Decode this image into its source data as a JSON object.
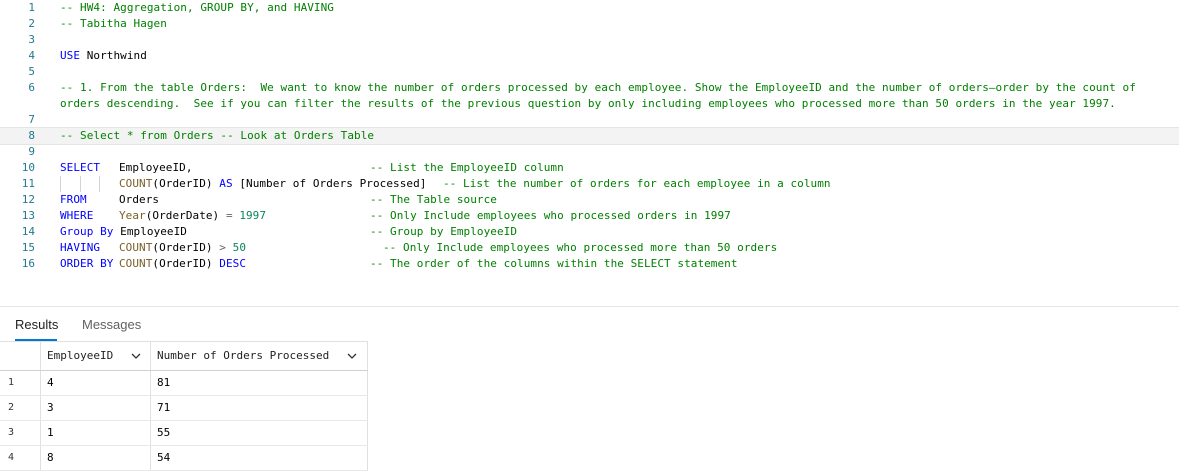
{
  "editor": {
    "line_numbers": [
      "1",
      "2",
      "3",
      "4",
      "5",
      "6",
      "7",
      "8",
      "9",
      "10",
      "11",
      "12",
      "13",
      "14",
      "15",
      "16"
    ],
    "line1": "-- HW4: Aggregation, GROUP BY, and HAVING",
    "line2": "-- Tabitha Hagen",
    "line4_kw": "USE",
    "line4_id": "Northwind",
    "line6": "-- 1. From the table Orders:  We want to know the number of orders processed by each employee. Show the EmployeeID and the number of orders—order by the count of orders descending.  See if you can filter the results of the previous question by only including employees who processed more than 50 orders in the year 1997.",
    "line8": "-- Select * from Orders -- Look at Orders Table",
    "line10_kw": "SELECT",
    "line10_id": "EmployeeID,",
    "line10_cm": "-- List the EmployeeID column",
    "line11_fn": "COUNT",
    "line11_arg": "(OrderID)",
    "line11_kw": "AS",
    "line11_alias": "[Number of Orders Processed]",
    "line11_cm": "-- List the number of orders for each employee in a column",
    "line12_kw": "FROM",
    "line12_id": "Orders",
    "line12_cm": "-- The Table source",
    "line13_kw": "WHERE",
    "line13_fn": "Year",
    "line13_arg": "(OrderDate)",
    "line13_op": "=",
    "line13_num": "1997",
    "line13_cm": "-- Only Include employees who processed orders in 1997",
    "line14_kw": "Group By",
    "line14_id": "EmployeeID",
    "line14_cm": "-- Group by EmployeeID",
    "line15_kw": "HAVING",
    "line15_fn": "COUNT",
    "line15_arg": "(OrderID)",
    "line15_op": ">",
    "line15_num": "50",
    "line15_cm": "-- Only Include employees who processed more than 50 orders",
    "line16_kw": "ORDER BY",
    "line16_fn": "COUNT",
    "line16_arg": "(OrderID)",
    "line16_kw2": "DESC",
    "line16_cm": "-- The order of the columns within the SELECT statement"
  },
  "results_panel": {
    "tabs": {
      "results": "Results",
      "messages": "Messages"
    },
    "columns": [
      "EmployeeID",
      "Number of Orders Processed"
    ],
    "rows": [
      {
        "num": "1",
        "employee_id": "4",
        "orders": "81"
      },
      {
        "num": "2",
        "employee_id": "3",
        "orders": "71"
      },
      {
        "num": "3",
        "employee_id": "1",
        "orders": "55"
      },
      {
        "num": "4",
        "employee_id": "8",
        "orders": "54"
      }
    ]
  },
  "icons": {
    "column_menu": "chevron-down-icon"
  },
  "colors": {
    "keyword": "#0000ff",
    "comment": "#008000",
    "line_number": "#237893",
    "function": "#795e26",
    "number": "#098658",
    "tab_accent": "#0078d4"
  }
}
